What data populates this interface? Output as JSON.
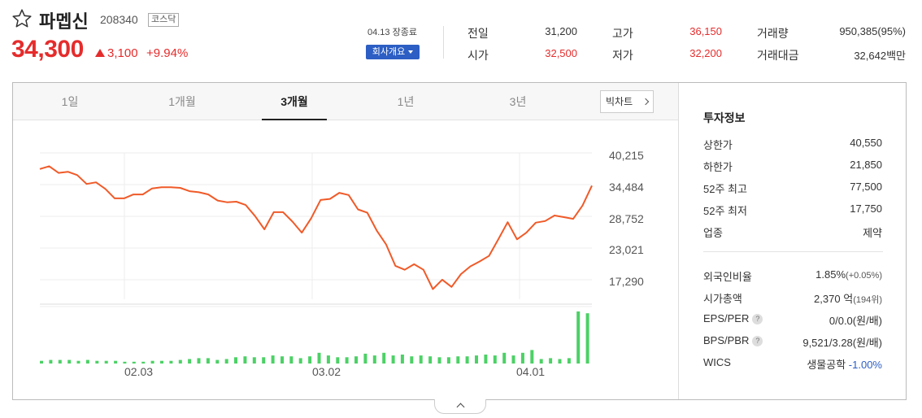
{
  "header": {
    "stock_name": "파멥신",
    "stock_code": "208340",
    "market": "코스닥",
    "price": "34,300",
    "change": "3,100",
    "change_rate": "+9.94%",
    "market_status": "04.13 장종료",
    "company_button": "회사개요"
  },
  "quotes": {
    "prev_close_label": "전일",
    "prev_close": "31,200",
    "high_label": "고가",
    "high": "36,150",
    "volume_label": "거래량",
    "volume": "950,385(95%)",
    "open_label": "시가",
    "open": "32,500",
    "low_label": "저가",
    "low": "32,200",
    "amount_label": "거래대금",
    "amount": "32,642백만"
  },
  "tabs": [
    "1일",
    "1개월",
    "3개월",
    "1년",
    "3년"
  ],
  "active_tab": "3개월",
  "big_chart_label": "빅차트",
  "chart_data": {
    "type": "line",
    "y_ticks": [
      "40,215",
      "34,484",
      "28,752",
      "23,021",
      "17,290"
    ],
    "x_ticks": [
      "02.03",
      "03.02",
      "04.01"
    ],
    "ylim": [
      17290,
      40215
    ],
    "price_series": [
      37300,
      37800,
      36600,
      36800,
      36200,
      34600,
      34900,
      33700,
      32000,
      32000,
      32700,
      32700,
      33800,
      34000,
      34000,
      33900,
      33300,
      33100,
      32700,
      31600,
      31300,
      31400,
      30800,
      28800,
      26400,
      29500,
      29500,
      27800,
      25800,
      28400,
      31700,
      31900,
      33000,
      32600,
      30000,
      29400,
      26200,
      23700,
      19800,
      19100,
      20100,
      19100,
      15600,
      17300,
      16000,
      18300,
      19700,
      20600,
      21600,
      24600,
      27700,
      24600,
      25800,
      27600,
      27900,
      28900,
      28600,
      28300,
      30700,
      34300
    ],
    "volume_series": [
      3,
      4,
      4,
      4,
      3,
      4,
      3,
      3,
      3,
      2,
      2,
      2,
      3,
      3,
      3,
      4,
      5,
      6,
      6,
      4,
      5,
      7,
      8,
      7,
      7,
      9,
      8,
      8,
      6,
      8,
      12,
      9,
      7,
      7,
      8,
      11,
      9,
      12,
      9,
      10,
      8,
      9,
      8,
      7,
      7,
      8,
      8,
      9,
      10,
      9,
      12,
      9,
      12,
      15,
      5,
      6,
      5,
      6,
      58,
      56
    ],
    "line_color": "#f05a28",
    "volume_color": "#4cd166"
  },
  "investment_info": {
    "title": "투자정보",
    "upper_limit_label": "상한가",
    "upper_limit": "40,550",
    "lower_limit_label": "하한가",
    "lower_limit": "21,850",
    "high52_label": "52주 최고",
    "high52": "77,500",
    "low52_label": "52주 최저",
    "low52": "17,750",
    "industry_label": "업종",
    "industry": "제약",
    "foreign_ratio_label": "외국인비율",
    "foreign_ratio": "1.85%",
    "foreign_ratio_change": "(+0.05%)",
    "market_cap_label": "시가총액",
    "market_cap": "2,370",
    "market_cap_unit": "억",
    "market_cap_rank": "(194위)",
    "eps_per_label": "EPS/PER",
    "eps_per": "0/0.0",
    "eps_per_unit": "(원/배)",
    "bps_pbr_label": "BPS/PBR",
    "bps_pbr": "9,521/3.28",
    "bps_pbr_unit": "(원/배)",
    "wics_label": "WICS",
    "wics": "생물공학",
    "wics_change": "-1.00%"
  },
  "colors": {
    "up": "#e52c2c",
    "down": "#2c5ec4",
    "button": "#2c5ec4"
  }
}
